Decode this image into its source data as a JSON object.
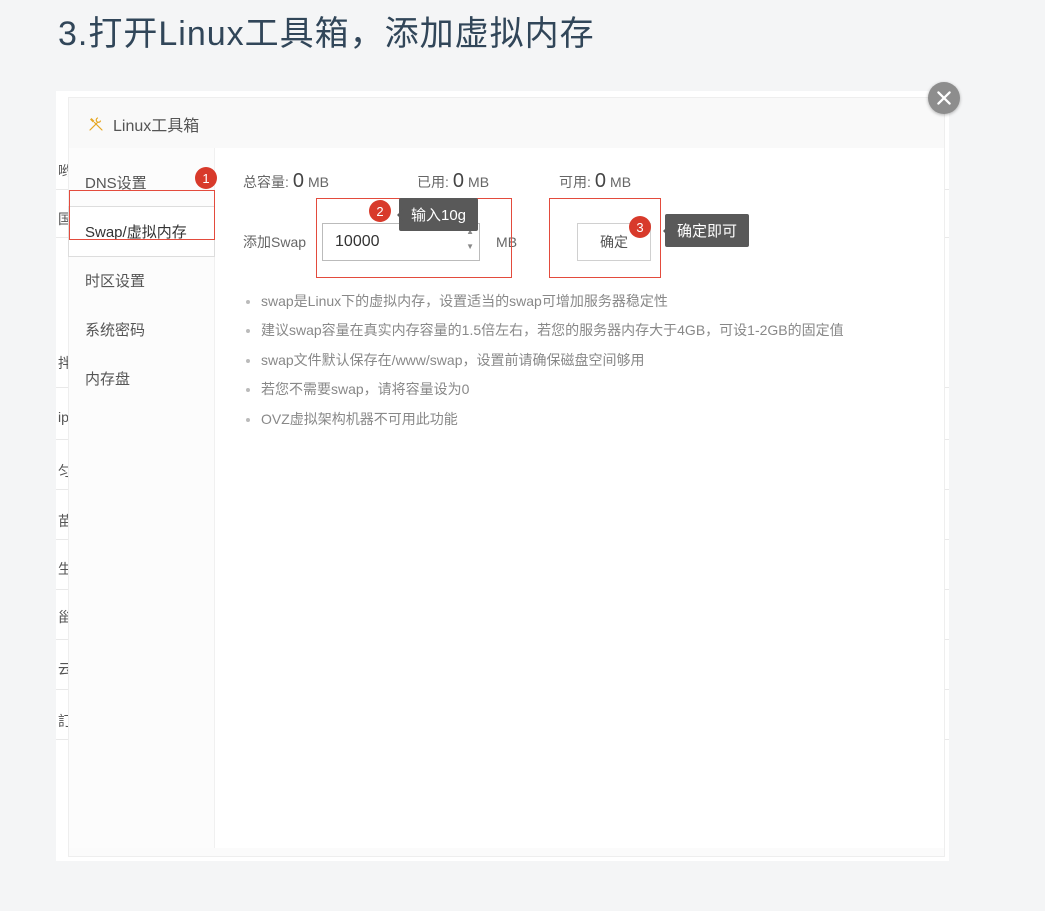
{
  "step_title": "3.打开Linux工具箱，添加虚拟内存",
  "modal": {
    "title": "Linux工具箱",
    "close_glyph": "×",
    "tabs": [
      {
        "label": "DNS设置"
      },
      {
        "label": "Swap/虚拟内存"
      },
      {
        "label": "时区设置"
      },
      {
        "label": "系统密码"
      },
      {
        "label": "内存盘"
      }
    ],
    "active_tab_index": 1
  },
  "stats": {
    "total_label": "总容量:",
    "total_value": "0",
    "total_unit": "MB",
    "used_label": "已用:",
    "used_value": "0",
    "used_unit": "MB",
    "avail_label": "可用:",
    "avail_value": "0",
    "avail_unit": "MB"
  },
  "form": {
    "label": "添加Swap",
    "value": "10000",
    "unit": "MB",
    "confirm_label": "确定"
  },
  "hints": [
    "swap是Linux下的虚拟内存，设置适当的swap可增加服务器稳定性",
    "建议swap容量在真实内存容量的1.5倍左右，若您的服务器内存大于4GB，可设1-2GB的固定值",
    "swap文件默认保存在/www/swap，设置前请确保磁盘空间够用",
    "若您不需要swap，请将容量设为0",
    "OVZ虚拟架构机器不可用此功能"
  ],
  "annotations": {
    "dot1": "1",
    "dot2": "2",
    "tip2": "输入10g",
    "dot3": "3",
    "tip3": "确定即可"
  },
  "bg_chars": [
    "哟",
    "国",
    "拌",
    "ip",
    "匀",
    "苗",
    "生",
    "甾",
    "云",
    "訂"
  ]
}
